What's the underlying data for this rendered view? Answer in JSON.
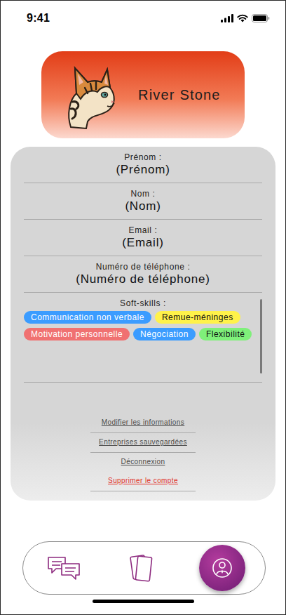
{
  "status_bar": {
    "time": "9:41"
  },
  "profile": {
    "name": "River Stone"
  },
  "fields": [
    {
      "label": "Prénom :",
      "value": "(Prénom)"
    },
    {
      "label": "Nom :",
      "value": "(Nom)"
    },
    {
      "label": "Email :",
      "value": "(Email)"
    },
    {
      "label": "Numéro de téléphone :",
      "value": "(Numéro de téléphone)"
    }
  ],
  "soft_skills": {
    "label": "Soft-skills :",
    "tags": [
      {
        "label": "Communication non verbale",
        "color": "#3b9cff"
      },
      {
        "label": "Remue-méninges",
        "color": "#fff24a"
      },
      {
        "label": "Motivation personnelle",
        "color": "#f07171"
      },
      {
        "label": "Négociation",
        "color": "#3b9cff"
      },
      {
        "label": "Flexibilité",
        "color": "#7ff07a"
      }
    ]
  },
  "links": [
    {
      "label": "Modifier les informations",
      "danger": false
    },
    {
      "label": "Entreprises sauvegardées",
      "danger": false
    },
    {
      "label": "Déconnexion",
      "danger": false
    },
    {
      "label": "Supprimer le compte",
      "danger": true
    }
  ],
  "nav": [
    {
      "kind": "chat",
      "selected": false
    },
    {
      "kind": "cards",
      "selected": false
    },
    {
      "kind": "profile",
      "selected": true
    }
  ]
}
